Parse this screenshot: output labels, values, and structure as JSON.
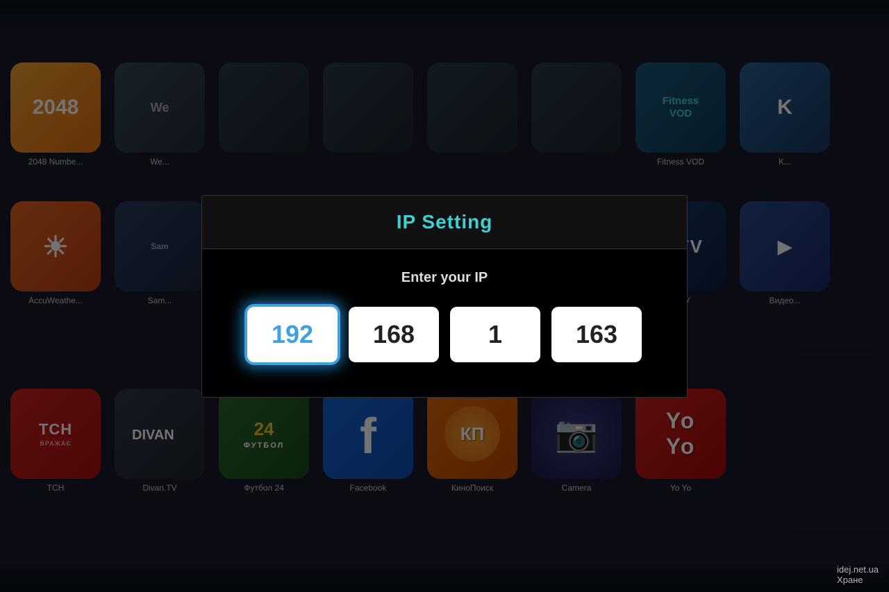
{
  "background": {
    "color": "#0d1520"
  },
  "dialog": {
    "title": "IP Setting",
    "subtitle": "Enter your IP",
    "fields": [
      {
        "id": "octet1",
        "value": "192",
        "active": true
      },
      {
        "id": "octet2",
        "value": "168",
        "active": false
      },
      {
        "id": "octet3",
        "value": "1",
        "active": false
      },
      {
        "id": "octet4",
        "value": "163",
        "active": false
      }
    ]
  },
  "apps": {
    "row1": [
      {
        "name": "2048 Numbe...",
        "icon_text": "2048",
        "icon_class": "icon-2048"
      },
      {
        "name": "We...",
        "icon_text": "We",
        "icon_class": "icon-we"
      },
      {
        "name": "",
        "icon_text": "",
        "icon_class": "icon-generic"
      },
      {
        "name": "",
        "icon_text": "",
        "icon_class": "icon-generic"
      },
      {
        "name": "",
        "icon_text": "",
        "icon_class": "icon-generic"
      },
      {
        "name": "",
        "icon_text": "",
        "icon_class": "icon-generic"
      },
      {
        "name": "Fitness VOD",
        "icon_text": "Fitness VOD",
        "icon_class": "icon-fitness"
      },
      {
        "name": "K...",
        "icon_text": "K",
        "icon_class": "icon-generic"
      }
    ],
    "row2": [
      {
        "name": "AccuWeathe...",
        "icon_text": "☀",
        "icon_class": "icon-weather"
      },
      {
        "name": "Sam...",
        "icon_text": "Sam",
        "icon_class": "icon-sam"
      },
      {
        "name": "",
        "icon_text": "",
        "icon_class": "icon-lock"
      },
      {
        "name": "",
        "icon_text": "",
        "icon_class": "icon-generic"
      },
      {
        "name": "",
        "icon_text": "",
        "icon_class": "icon-generic"
      },
      {
        "name": "",
        "icon_text": "",
        "icon_class": "icon-generic"
      },
      {
        "name": "IPTV",
        "icon_text": "IPTV",
        "icon_class": "icon-iptv"
      },
      {
        "name": "Видео...",
        "icon_text": "▶",
        "icon_class": "icon-video"
      }
    ],
    "row3": [
      {
        "name": "ТСН",
        "icon_text": "ТСН ВРАЖАЄ",
        "icon_class": "icon-tch"
      },
      {
        "name": "Divan.TV",
        "icon_text": "Divan.TV",
        "icon_class": "icon-divan"
      },
      {
        "name": "Футбол 24",
        "icon_text": "24 ФУТБОЛ",
        "icon_class": "icon-futbol"
      },
      {
        "name": "Facebook",
        "icon_text": "f",
        "icon_class": "icon-facebook"
      },
      {
        "name": "КиноПоиск",
        "icon_text": "КП",
        "icon_class": "icon-kino"
      },
      {
        "name": "Camera",
        "icon_text": "📷",
        "icon_class": "icon-camera"
      },
      {
        "name": "Yo Yo",
        "icon_text": "Yo",
        "icon_class": "icon-yoyo"
      }
    ]
  },
  "watermark": {
    "line1": "idej.net.ua",
    "line2": "Хране"
  }
}
